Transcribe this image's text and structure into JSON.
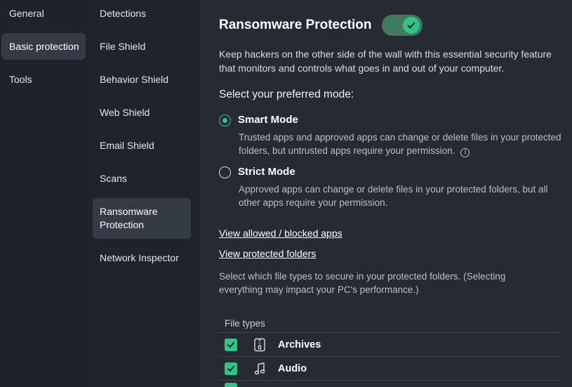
{
  "nav_primary": [
    {
      "label": "General"
    },
    {
      "label": "Basic protection"
    },
    {
      "label": "Tools"
    }
  ],
  "nav_secondary": [
    {
      "label": "Detections"
    },
    {
      "label": "File Shield"
    },
    {
      "label": "Behavior Shield"
    },
    {
      "label": "Web Shield"
    },
    {
      "label": "Email Shield"
    },
    {
      "label": "Scans"
    },
    {
      "label": "Ransomware Protection"
    },
    {
      "label": "Network Inspector"
    }
  ],
  "main": {
    "title": "Ransomware Protection",
    "toggle_on": true,
    "description": "Keep hackers on the other side of the wall with this essential security feature that monitors and controls what goes in and out of your computer.",
    "mode_heading": "Select your preferred mode:",
    "modes": [
      {
        "title": "Smart Mode",
        "description": "Trusted apps and approved apps can change or delete files in your protected folders, but untrusted apps require your permission.",
        "selected": true
      },
      {
        "title": "Strict Mode",
        "description": "Approved apps can change or delete files in your protected folders, but all other apps require your permission.",
        "selected": false
      }
    ],
    "links": {
      "allowed_blocked": "View allowed / blocked apps",
      "protected_folders": "View protected folders"
    },
    "file_types_note": "Select which file types to secure in your protected folders. (Selecting everything may impact your PC's performance.)",
    "file_types_header": "File types",
    "file_types": [
      {
        "label": "Archives",
        "icon": "archive-zip-icon",
        "checked": true
      },
      {
        "label": "Audio",
        "icon": "music-note-icon",
        "checked": true
      }
    ]
  },
  "colors": {
    "accent": "#31c489",
    "background": "#262b33",
    "nav_background": "#1e2229",
    "active_item": "#353b45"
  }
}
